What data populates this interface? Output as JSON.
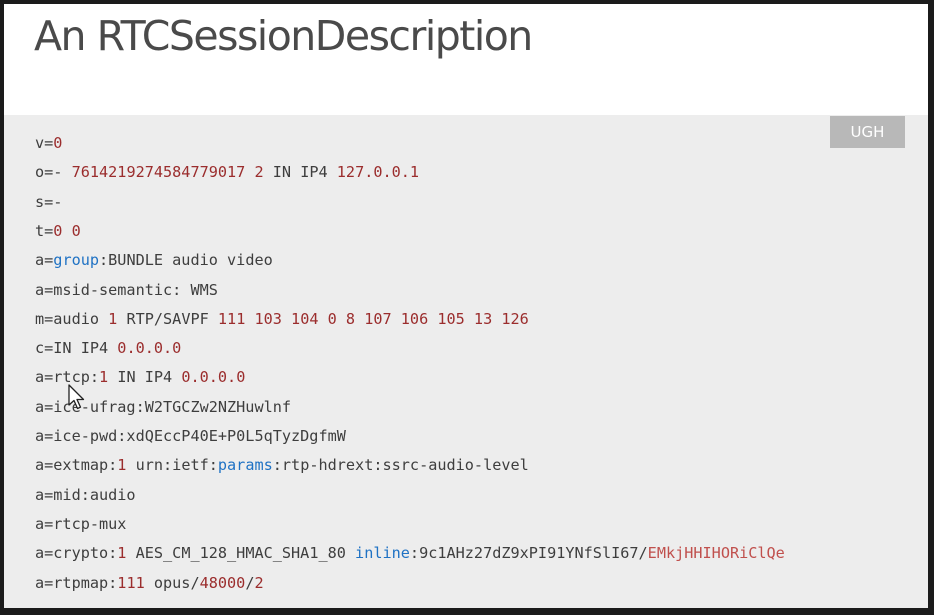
{
  "slide": {
    "title": "An RTCSessionDescription",
    "badge": "UGH"
  },
  "colors": {
    "background": "#ffffff",
    "code_background": "#ededed",
    "badge_background": "#b8b8b8",
    "text": "#3e3e3e",
    "number": "#9b2d2d",
    "keyword": "#1f72c4",
    "string": "#c0504d"
  },
  "pointer": {
    "icon": "mouse-pointer-icon"
  },
  "sdp": {
    "lines": [
      [
        {
          "text": "v="
        },
        {
          "text": "0",
          "type": "num"
        }
      ],
      [
        {
          "text": "o=- "
        },
        {
          "text": "7614219274584779017",
          "type": "num"
        },
        {
          "text": " "
        },
        {
          "text": "2",
          "type": "num"
        },
        {
          "text": " IN IP4 "
        },
        {
          "text": "127.0.0.1",
          "type": "num"
        }
      ],
      [
        {
          "text": "s=-"
        }
      ],
      [
        {
          "text": "t="
        },
        {
          "text": "0",
          "type": "num"
        },
        {
          "text": " "
        },
        {
          "text": "0",
          "type": "num"
        }
      ],
      [
        {
          "text": "a="
        },
        {
          "text": "group",
          "type": "kw"
        },
        {
          "text": ":BUNDLE audio video"
        }
      ],
      [
        {
          "text": "a=msid-semantic: WMS"
        }
      ],
      [
        {
          "text": "m=audio "
        },
        {
          "text": "1",
          "type": "num"
        },
        {
          "text": " RTP/SAVPF "
        },
        {
          "text": "111 103 104 0 8 107 106 105 13 126",
          "type": "num"
        }
      ],
      [
        {
          "text": "c=IN IP4 "
        },
        {
          "text": "0.0.0.0",
          "type": "num"
        }
      ],
      [
        {
          "text": "a=rtcp:"
        },
        {
          "text": "1",
          "type": "num"
        },
        {
          "text": " IN IP4 "
        },
        {
          "text": "0.0.0.0",
          "type": "num"
        }
      ],
      [
        {
          "text": "a=ice-ufrag:W2TGCZw2NZHuwlnf"
        }
      ],
      [
        {
          "text": "a=ice-pwd:xdQEccP40E+P0L5qTyzDgfmW"
        }
      ],
      [
        {
          "text": "a=extmap:"
        },
        {
          "text": "1",
          "type": "num"
        },
        {
          "text": " urn:ietf:"
        },
        {
          "text": "params",
          "type": "kw"
        },
        {
          "text": ":rtp-hdrext:ssrc-audio-level"
        }
      ],
      [
        {
          "text": "a=mid:audio"
        }
      ],
      [
        {
          "text": "a=rtcp-mux"
        }
      ],
      [
        {
          "text": "a=crypto:"
        },
        {
          "text": "1",
          "type": "num"
        },
        {
          "text": " AES_CM_128_HMAC_SHA1_80 "
        },
        {
          "text": "inline",
          "type": "kw"
        },
        {
          "text": ":9c1AHz27dZ9xPI91YNfSlI67/"
        },
        {
          "text": "EMkjHHIHORiClQe",
          "type": "str"
        }
      ],
      [
        {
          "text": "a=rtpmap:"
        },
        {
          "text": "111",
          "type": "num"
        },
        {
          "text": " opus/"
        },
        {
          "text": "48000",
          "type": "num"
        },
        {
          "text": "/"
        },
        {
          "text": "2",
          "type": "num"
        }
      ]
    ]
  }
}
